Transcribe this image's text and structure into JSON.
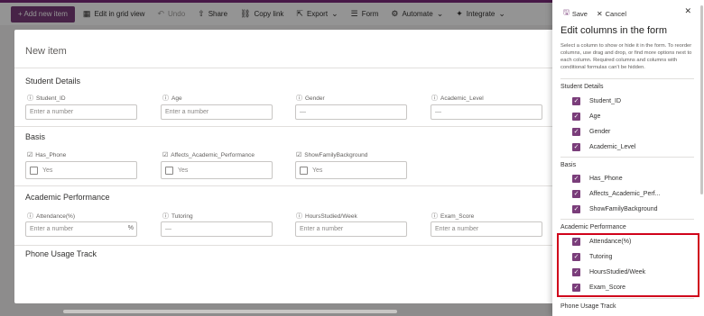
{
  "toolbar": {
    "add_new_item": "+ Add new item",
    "edit_grid": "Edit in grid view",
    "undo": "Undo",
    "share": "Share",
    "copy_link": "Copy link",
    "export": "Export",
    "form": "Form",
    "automate": "Automate",
    "integrate": "Integrate"
  },
  "form": {
    "title": "New item",
    "sections": {
      "student": "Student Details",
      "basis": "Basis",
      "academic": "Academic Performance",
      "phone": "Phone Usage Track"
    },
    "fields": {
      "student_id": {
        "label": "Student_ID",
        "placeholder": "Enter a number"
      },
      "age": {
        "label": "Age",
        "placeholder": "Enter a number"
      },
      "gender": {
        "label": "Gender",
        "value": "—"
      },
      "academic_level": {
        "label": "Academic_Level",
        "value": "—"
      },
      "has_phone": {
        "label": "Has_Phone",
        "value": "Yes"
      },
      "affects": {
        "label": "Affects_Academic_Performance",
        "value": "Yes"
      },
      "show_family": {
        "label": "ShowFamilyBackground",
        "value": "Yes"
      },
      "attendance": {
        "label": "Attendance(%)",
        "placeholder": "Enter a number",
        "suffix": "%"
      },
      "tutoring": {
        "label": "Tutoring",
        "value": "—"
      },
      "hours": {
        "label": "HoursStudied/Week",
        "placeholder": "Enter a number"
      },
      "exam": {
        "label": "Exam_Score",
        "placeholder": "Enter a number"
      }
    }
  },
  "panel": {
    "save": "Save",
    "cancel": "Cancel",
    "title": "Edit columns in the form",
    "description": "Select a column to show or hide it in the form. To reorder columns, use drag and drop, or find more options next to each column. Required columns and columns with conditional formulas can't be hidden.",
    "sections": {
      "student": "Student Details",
      "basis": "Basis",
      "academic": "Academic Performance",
      "phone": "Phone Usage Track"
    },
    "items": {
      "student_id": "Student_ID",
      "age": "Age",
      "gender": "Gender",
      "academic_level": "Academic_Level",
      "has_phone": "Has_Phone",
      "affects": "Affects_Academic_Perf...",
      "show_family": "ShowFamilyBackground",
      "attendance": "Attendance(%)",
      "tutoring": "Tutoring",
      "hours": "HoursStudied/Week",
      "exam": "Exam_Score"
    },
    "check_glyph": "✓"
  },
  "colors": {
    "accent": "#7a3d7a",
    "highlight": "#d0021b"
  }
}
